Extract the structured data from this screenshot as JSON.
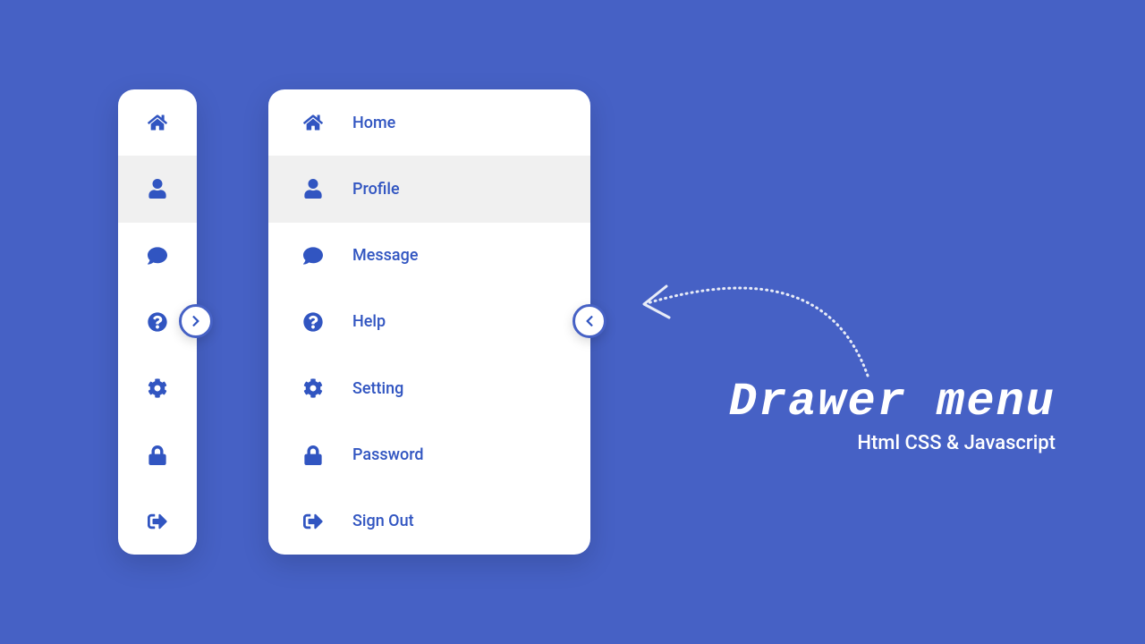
{
  "menu": {
    "items": [
      {
        "icon": "home",
        "label": "Home"
      },
      {
        "icon": "user",
        "label": "Profile",
        "active": true
      },
      {
        "icon": "comment",
        "label": "Message"
      },
      {
        "icon": "question",
        "label": "Help"
      },
      {
        "icon": "gear",
        "label": "Setting"
      },
      {
        "icon": "lock",
        "label": "Password"
      },
      {
        "icon": "signout",
        "label": "Sign Out"
      }
    ]
  },
  "title": {
    "main": "Drawer menu",
    "sub": "Html CSS & Javascript"
  },
  "colors": {
    "bg": "#4661c5",
    "accent": "#3155c1",
    "panel": "#ffffff"
  }
}
